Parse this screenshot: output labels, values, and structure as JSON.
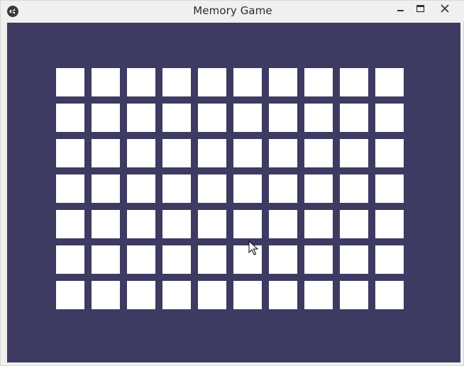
{
  "window": {
    "title": "Memory Game",
    "app_icon": "kivy-logo-icon",
    "controls": [
      "minimize-icon",
      "maximize-icon",
      "close-icon"
    ]
  },
  "colors": {
    "background": "#3d3b61",
    "card_back": "#ffffff",
    "titlebar": "#f0f0f0"
  },
  "board": {
    "rows": 7,
    "columns": 10,
    "cards_face_down": 70
  }
}
